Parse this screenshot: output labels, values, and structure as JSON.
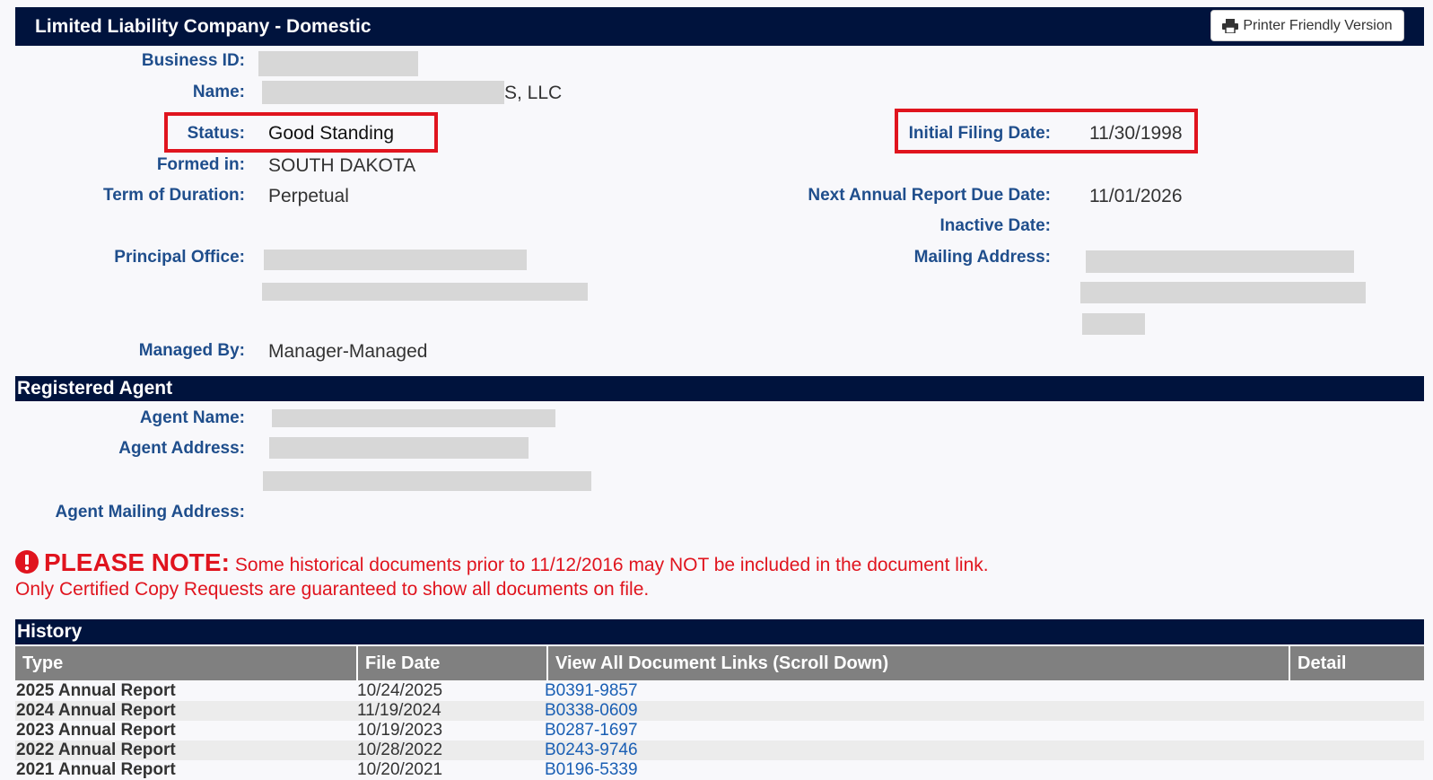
{
  "header": {
    "title": "Limited Liability Company - Domestic",
    "print_button": "Printer Friendly Version"
  },
  "details": {
    "business_id_label": "Business ID:",
    "name_label": "Name:",
    "name_suffix": "S, LLC",
    "status_label": "Status:",
    "status_value": "Good Standing",
    "formed_in_label": "Formed in:",
    "formed_in_value": "SOUTH DAKOTA",
    "term_label": "Term of Duration:",
    "term_value": "Perpetual",
    "principal_office_label": "Principal Office:",
    "managed_by_label": "Managed By:",
    "managed_by_value": "Manager-Managed",
    "initial_filing_label": "Initial Filing Date:",
    "initial_filing_value": "11/30/1998",
    "next_report_label": "Next Annual Report Due Date:",
    "next_report_value": "11/01/2026",
    "inactive_label": "Inactive Date:",
    "mailing_label": "Mailing Address:"
  },
  "agent": {
    "section_title": "Registered Agent",
    "name_label": "Agent Name:",
    "address_label": "Agent Address:",
    "mailing_label": "Agent Mailing Address:"
  },
  "notice": {
    "heading": "PLEASE NOTE:",
    "line1": "Some historical documents prior to 11/12/2016 may NOT be included in the document link.",
    "line2": "Only Certified Copy Requests are guaranteed to show all documents on file."
  },
  "history": {
    "section_title": "History",
    "columns": [
      "Type",
      "File Date",
      "View All Document Links (Scroll Down)",
      "Detail"
    ],
    "rows": [
      {
        "type": "2025 Annual Report",
        "date": "10/24/2025",
        "doc": "B0391-9857"
      },
      {
        "type": "2024 Annual Report",
        "date": "11/19/2024",
        "doc": "B0338-0609"
      },
      {
        "type": "2023 Annual Report",
        "date": "10/19/2023",
        "doc": "B0287-1697"
      },
      {
        "type": "2022 Annual Report",
        "date": "10/28/2022",
        "doc": "B0243-9746"
      },
      {
        "type": "2021 Annual Report",
        "date": "10/20/2021",
        "doc": "B0196-5339"
      }
    ]
  },
  "colors": {
    "header_bg": "#00133d",
    "label": "#1f4e8c",
    "highlight": "#e0141e",
    "link": "#1a5fb4",
    "table_header": "#808080"
  }
}
